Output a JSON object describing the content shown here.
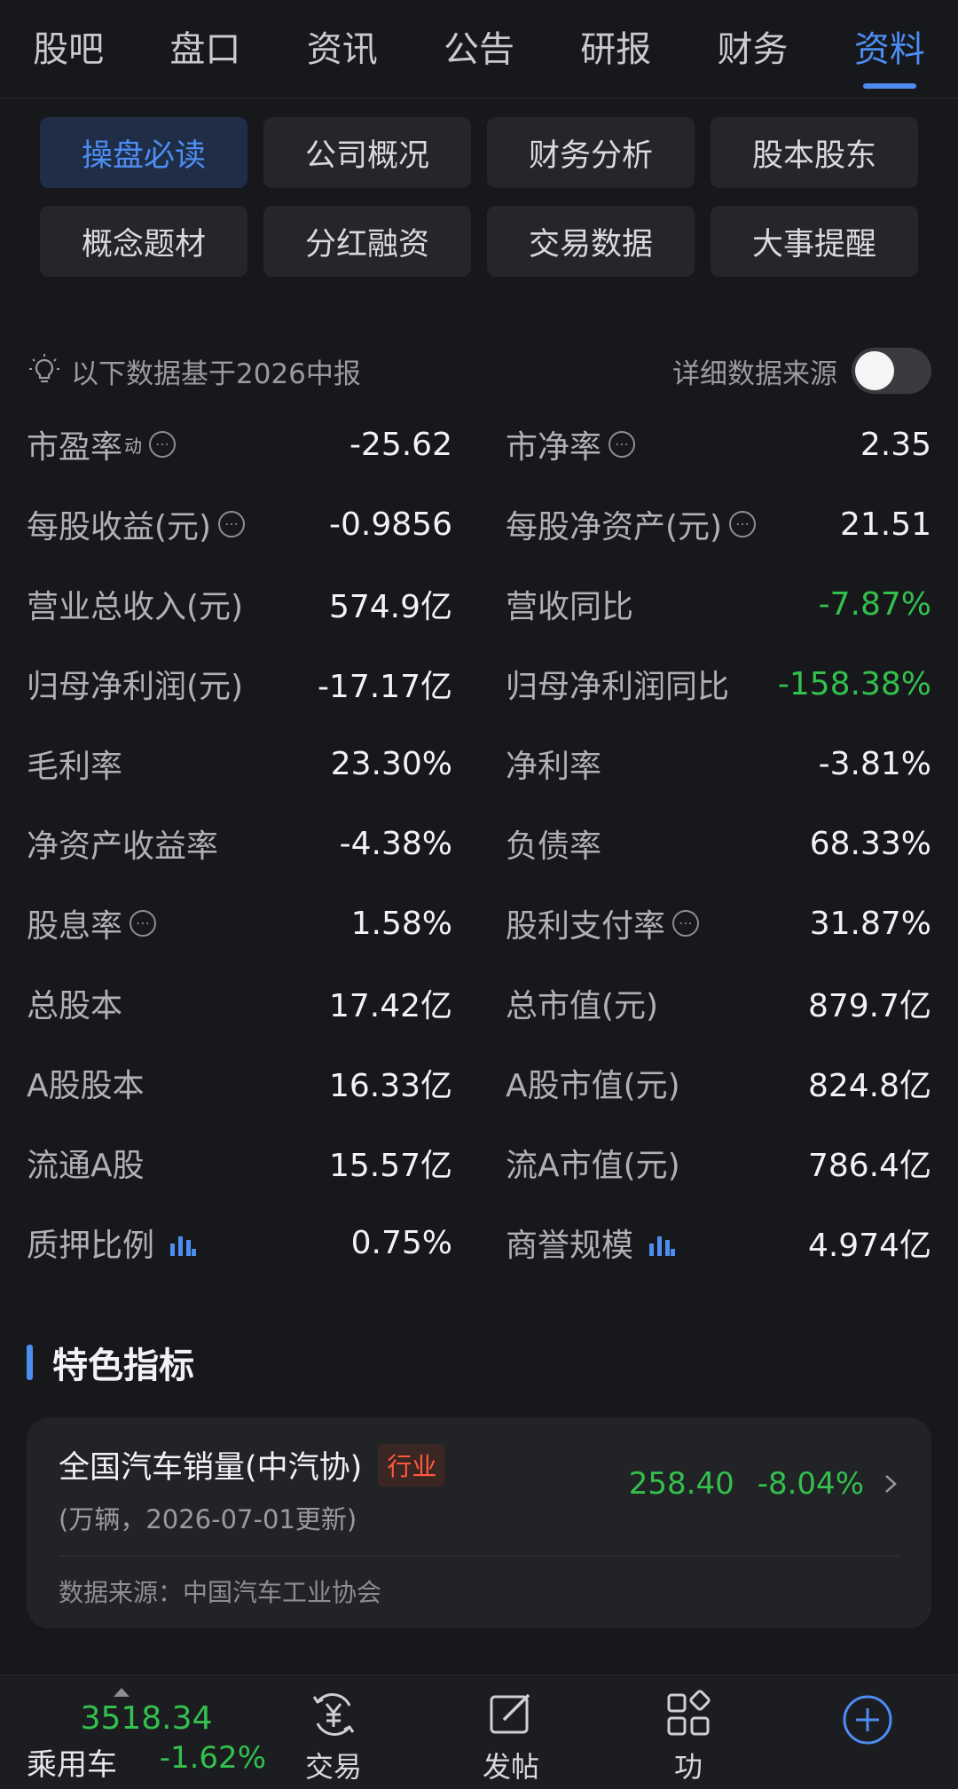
{
  "tabs": [
    {
      "label": "股吧",
      "active": false
    },
    {
      "label": "盘口",
      "active": false
    },
    {
      "label": "资讯",
      "active": false
    },
    {
      "label": "公告",
      "active": false
    },
    {
      "label": "研报",
      "active": false
    },
    {
      "label": "财务",
      "active": false
    },
    {
      "label": "资料",
      "active": true
    }
  ],
  "chips": [
    {
      "label": "操盘必读",
      "active": true
    },
    {
      "label": "公司概况",
      "active": false
    },
    {
      "label": "财务分析",
      "active": false
    },
    {
      "label": "股本股东",
      "active": false
    },
    {
      "label": "概念题材",
      "active": false
    },
    {
      "label": "分红融资",
      "active": false
    },
    {
      "label": "交易数据",
      "active": false
    },
    {
      "label": "大事提醒",
      "active": false
    }
  ],
  "basis": {
    "text": "以下数据基于2026中报",
    "source_toggle_label": "详细数据来源",
    "toggle_on": false
  },
  "metrics": [
    [
      {
        "label": "市盈率",
        "sup": "动",
        "info": true,
        "value": "-25.62"
      },
      {
        "label": "市净率",
        "info": true,
        "value": "2.35"
      }
    ],
    [
      {
        "label": "每股收益(元)",
        "info": true,
        "value": "-0.9856"
      },
      {
        "label": "每股净资产(元)",
        "info": true,
        "value": "21.51"
      }
    ],
    [
      {
        "label": "营业总收入(元)",
        "value": "574.9亿"
      },
      {
        "label": "营收同比",
        "value": "-7.87%",
        "color": "#33c04d"
      }
    ],
    [
      {
        "label": "归母净利润(元)",
        "value": "-17.17亿"
      },
      {
        "label": "归母净利润同比",
        "value": "-158.38%",
        "color": "#33c04d"
      }
    ],
    [
      {
        "label": "毛利率",
        "value": "23.30%"
      },
      {
        "label": "净利率",
        "value": "-3.81%"
      }
    ],
    [
      {
        "label": "净资产收益率",
        "value": "-4.38%"
      },
      {
        "label": "负债率",
        "value": "68.33%"
      }
    ],
    [
      {
        "label": "股息率",
        "info": true,
        "value": "1.58%"
      },
      {
        "label": "股利支付率",
        "info": true,
        "value": "31.87%"
      }
    ],
    [
      {
        "label": "总股本",
        "value": "17.42亿"
      },
      {
        "label": "总市值(元)",
        "value": "879.7亿"
      }
    ],
    [
      {
        "label": "A股股本",
        "value": "16.33亿"
      },
      {
        "label": "A股市值(元)",
        "value": "824.8亿"
      }
    ],
    [
      {
        "label": "流通A股",
        "value": "15.57亿"
      },
      {
        "label": "流A市值(元)",
        "value": "786.4亿"
      }
    ],
    [
      {
        "label": "质押比例",
        "chart_icon": true,
        "value": "0.75%"
      },
      {
        "label": "商誉规模",
        "chart_icon": true,
        "value": "4.974亿"
      }
    ]
  ],
  "section": {
    "title": "特色指标"
  },
  "indicator_card": {
    "title": "全国汽车销量(中汽协)",
    "badge": "行业",
    "subtitle": "(万辆，2026-07-01更新)",
    "value": "258.40",
    "change": "-8.04%",
    "source": "数据来源：中国汽车工业协会"
  },
  "bottom_bar": {
    "index_value": "3518.34",
    "index_name": "乘用车",
    "index_change": "-1.62%",
    "items": [
      {
        "label": "交易",
        "icon": "yen-exchange-icon"
      },
      {
        "label": "发帖",
        "icon": "edit-post-icon"
      },
      {
        "label": "功",
        "icon": "grid-apps-icon"
      }
    ],
    "add_icon": "plus-circle-icon"
  },
  "colors": {
    "accent": "#4d8df2",
    "down_green": "#33c04d",
    "background": "#17181c",
    "badge_red": "#ff5a3c"
  }
}
